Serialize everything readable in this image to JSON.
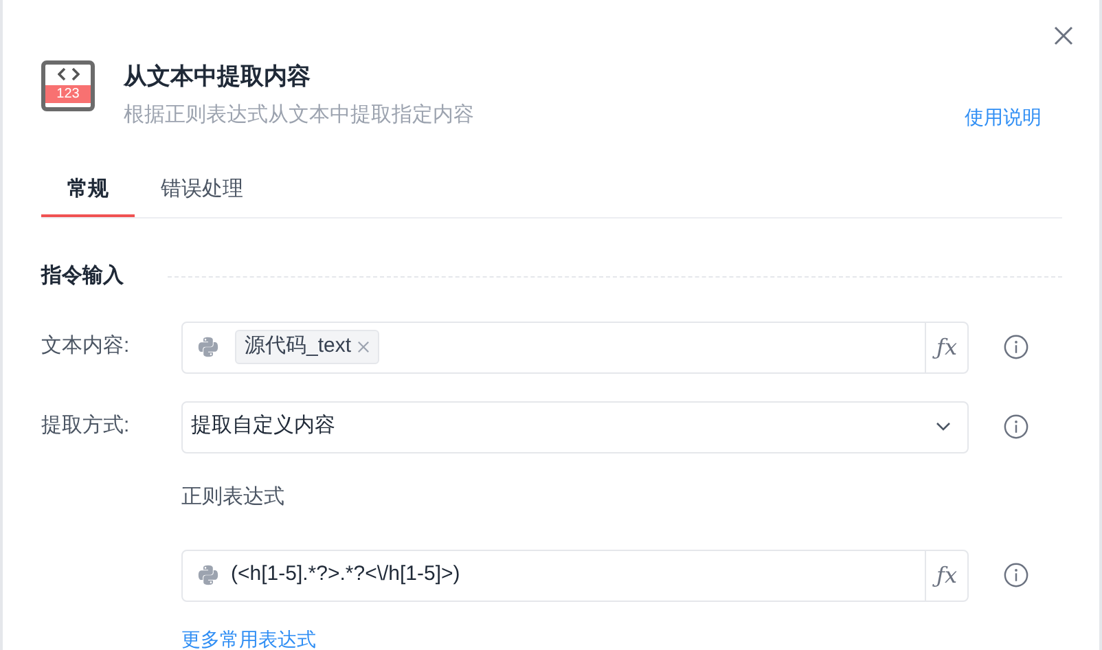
{
  "header": {
    "title": "从文本中提取内容",
    "subtitle": "根据正则表达式从文本中提取指定内容",
    "help_link": "使用说明",
    "icon_text": "123"
  },
  "tabs": [
    {
      "label": "常规",
      "selected": true
    },
    {
      "label": "错误处理",
      "selected": false
    }
  ],
  "section": {
    "title": "指令输入"
  },
  "rows": [
    {
      "kind": "token",
      "label": "文本内容:",
      "tag": "源代码_text",
      "fx": "ƒx"
    },
    {
      "kind": "select",
      "label": "提取方式:",
      "value": "提取自定义内容"
    },
    {
      "kind": "caption",
      "text": "正则表达式"
    },
    {
      "kind": "expression",
      "value": "(<h[1-5].*?>.*?<\\/h[1-5]>)",
      "fx": "ƒx"
    }
  ],
  "more_link": "更多常用表达式"
}
